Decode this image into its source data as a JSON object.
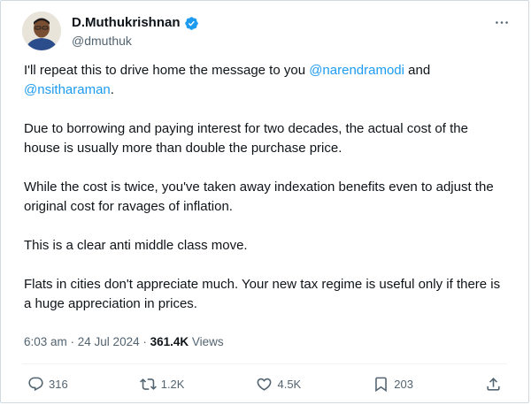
{
  "author": {
    "display_name": "D.Muthukrishnan",
    "handle": "@dmuthuk",
    "verified": true
  },
  "tweet": {
    "p1": {
      "t1": "I'll repeat this to drive home the message to you ",
      "m1": "@narendramodi",
      "t2": " and ",
      "m2": "@nsitharaman",
      "t3": "."
    },
    "p2": "Due to borrowing and paying interest for two decades, the actual cost of the house is usually more than double the purchase price.",
    "p3": "While the cost is twice, you've taken away indexation benefits even to adjust the original cost for ravages of inflation.",
    "p4": "This is a clear anti middle class move.",
    "p5": "Flats in cities don't appreciate much. Your new tax regime is useful only if there is a huge appreciation in prices."
  },
  "meta": {
    "time": "6:03 am",
    "separator": " · ",
    "date": "24 Jul 2024",
    "views_count": "361.4K",
    "views_label": " Views"
  },
  "actions": {
    "replies": "316",
    "retweets": "1.2K",
    "likes": "4.5K",
    "bookmarks": "203"
  },
  "colors": {
    "accent": "#1d9bf0",
    "text": "#0f1419",
    "secondary": "#536471",
    "border": "#cfd9de"
  },
  "icons": [
    "verified-badge-icon",
    "more-options-icon",
    "reply-icon",
    "retweet-icon",
    "like-icon",
    "bookmark-icon",
    "share-icon"
  ]
}
